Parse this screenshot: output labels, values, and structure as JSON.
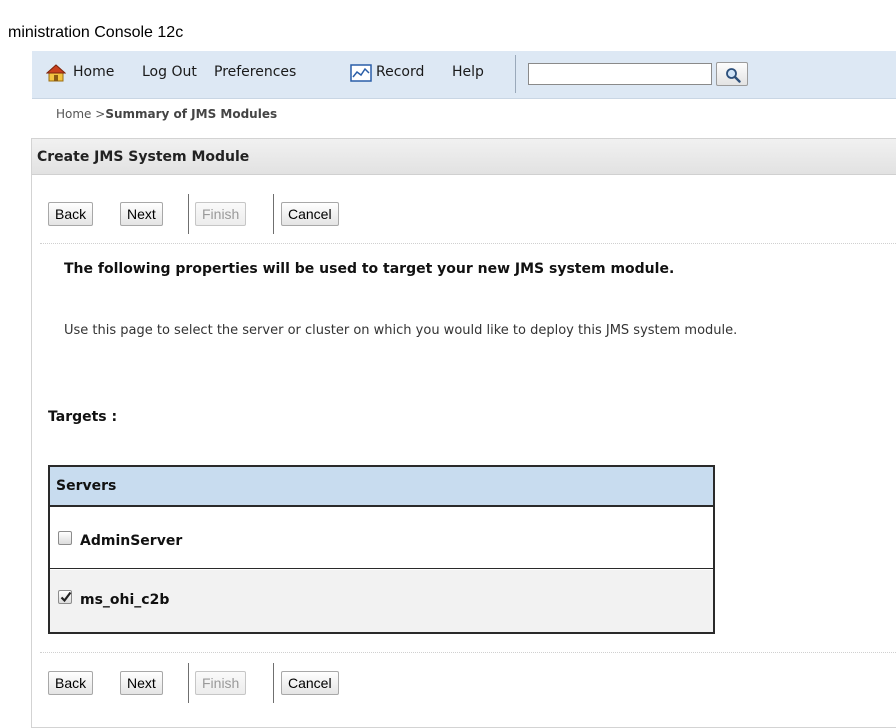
{
  "app": {
    "title": "ministration Console 12c"
  },
  "toolbar": {
    "home": "Home",
    "logout": "Log Out",
    "preferences": "Preferences",
    "record": "Record",
    "help": "Help",
    "search_value": "",
    "icons": {
      "home": "home-icon",
      "record": "record-icon",
      "search": "search-icon"
    }
  },
  "breadcrumb": {
    "home": "Home >",
    "current": "Summary of JMS Modules"
  },
  "panel": {
    "title": "Create JMS System Module",
    "buttons": {
      "back": "Back",
      "next": "Next",
      "finish": "Finish",
      "cancel": "Cancel"
    },
    "heading": "The following properties will be used to target your new JMS system module.",
    "description": "Use this page to select the server or cluster on which you would like to deploy this JMS system module.",
    "targets_label": "Targets :",
    "table": {
      "header": "Servers",
      "rows": [
        {
          "name": "AdminServer",
          "checked": false
        },
        {
          "name": "ms_ohi_c2b",
          "checked": true
        }
      ]
    }
  },
  "colors": {
    "toolbar_bg": "#dde8f4",
    "table_header_bg": "#c8dcef"
  }
}
